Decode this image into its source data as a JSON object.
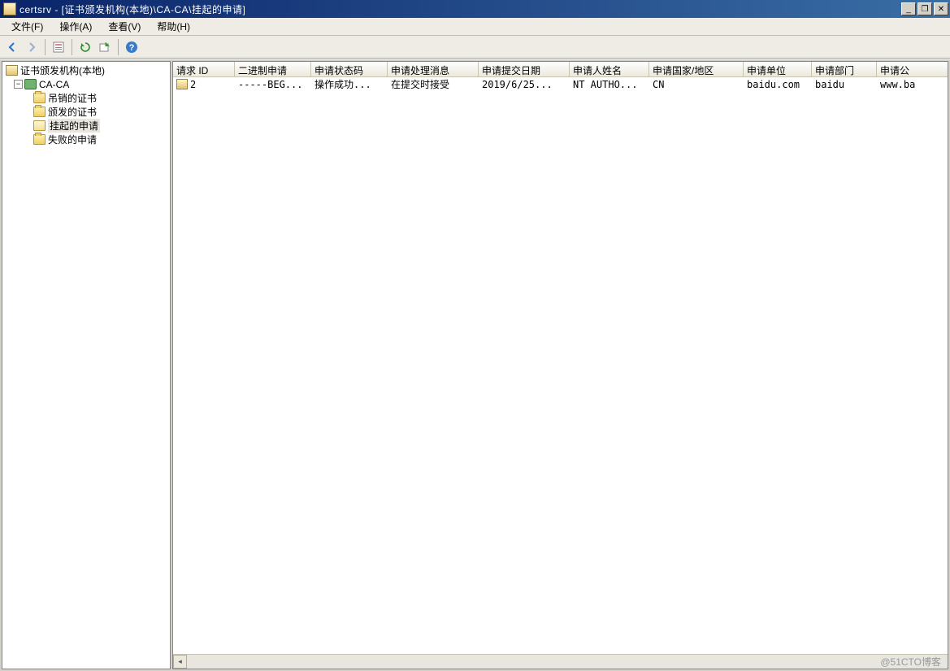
{
  "window": {
    "title": "certsrv - [证书颁发机构(本地)\\CA-CA\\挂起的申请]"
  },
  "menubar": {
    "file": "文件(F)",
    "action": "操作(A)",
    "view": "查看(V)",
    "help": "帮助(H)"
  },
  "tree": {
    "root": "证书颁发机构(本地)",
    "ca": "CA-CA",
    "revoked": "吊销的证书",
    "issued": "颁发的证书",
    "pending": "挂起的申请",
    "failed": "失败的申请"
  },
  "columns": {
    "c0": "请求 ID",
    "c1": "二进制申请",
    "c2": "申请状态码",
    "c3": "申请处理消息",
    "c4": "申请提交日期",
    "c5": "申请人姓名",
    "c6": "申请国家/地区",
    "c7": "申请单位",
    "c8": "申请部门",
    "c9": "申请公"
  },
  "rows": [
    {
      "c0": "2",
      "c1": "-----BEG...",
      "c2": "操作成功...",
      "c3": "在提交时接受",
      "c4": "2019/6/25...",
      "c5": "NT AUTHO...",
      "c6": "CN",
      "c7": "baidu.com",
      "c8": "baidu",
      "c9": "www.ba"
    }
  ],
  "watermark": "@51CTO博客"
}
